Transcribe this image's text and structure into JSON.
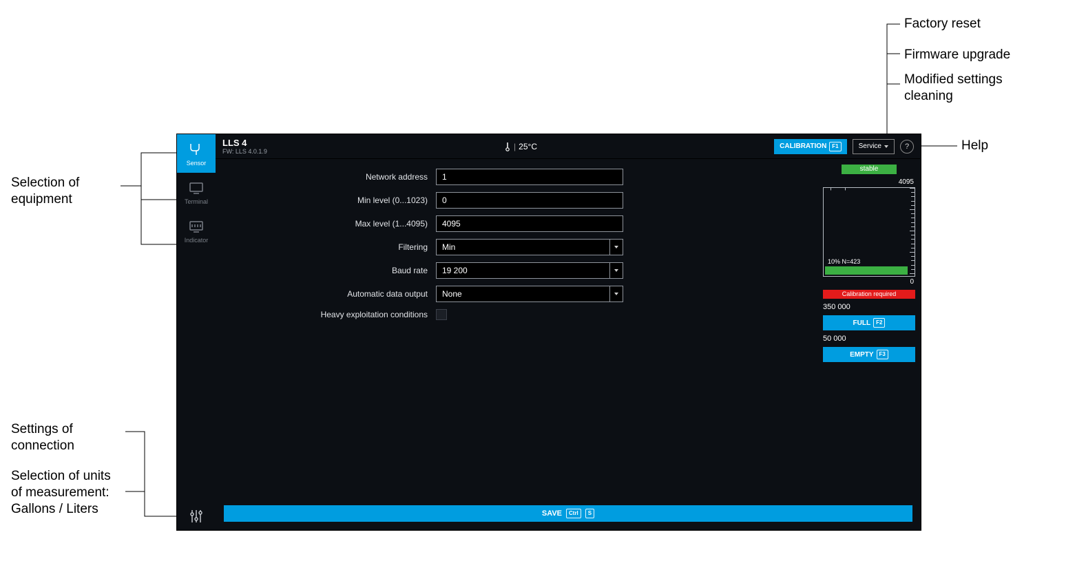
{
  "colors": {
    "accent": "#009de0",
    "success": "#3cb043",
    "danger": "#e31b1b"
  },
  "header": {
    "title": "LLS 4",
    "fw": "FW: LLS 4.0.1.9",
    "temp": "25°C",
    "calibration_label": "CALIBRATION",
    "calibration_key": "F1",
    "service_label": "Service"
  },
  "sidebar": {
    "items": [
      {
        "id": "sensor",
        "label": "Sensor",
        "active": true
      },
      {
        "id": "terminal",
        "label": "Terminal",
        "active": false
      },
      {
        "id": "indicator",
        "label": "Indicator",
        "active": false
      }
    ]
  },
  "form": {
    "network_address": {
      "label": "Network address",
      "value": "1"
    },
    "min_level": {
      "label": "Min level (0...1023)",
      "value": "0"
    },
    "max_level": {
      "label": "Max level (1...4095)",
      "value": "4095"
    },
    "filtering": {
      "label": "Filtering",
      "value": "Min"
    },
    "baud_rate": {
      "label": "Baud rate",
      "value": "19 200"
    },
    "auto_output": {
      "label": "Automatic data output",
      "value": "None"
    },
    "heavy_cond": {
      "label": "Heavy exploitation conditions",
      "value": false
    }
  },
  "gauge": {
    "status": "stable",
    "max": "4095",
    "min": "0",
    "percent": "10%",
    "n_value": "N=423",
    "cal_required": "Calibration required",
    "full_value": "350 000",
    "full_label": "FULL",
    "full_key": "F2",
    "empty_value": "50 000",
    "empty_label": "EMPTY",
    "empty_key": "F3"
  },
  "footer": {
    "save_label": "SAVE",
    "save_key1": "Ctrl",
    "save_key2": "S"
  },
  "annotations": {
    "equipment": "Selection of equipment",
    "factory_reset": "Factory reset",
    "firmware_upgrade": "Firmware upgrade",
    "modified_clean": "Modified settings cleaning",
    "help": "Help",
    "connection": "Settings of connection",
    "units": "Selection of units of measurement: Gallons / Liters"
  }
}
